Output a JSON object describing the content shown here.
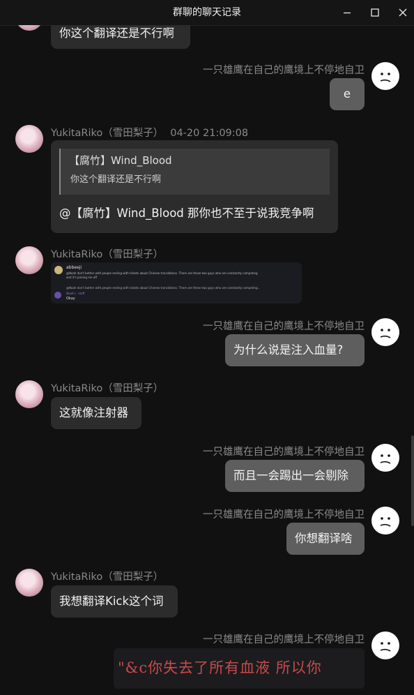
{
  "window": {
    "title": "群聊的聊天记录"
  },
  "users": {
    "left_name": "YukitaRiko（雪田梨子）",
    "right_name": "一只雄鹰在自己的鹰境上不停地自卫"
  },
  "messages": {
    "m0_text": "你这个翻译还是不行啊",
    "m1_text": "e",
    "m2_time": "04-20 21:09:08",
    "m2_quote_name": "【腐竹】Wind_Blood",
    "m2_quote_text": "你这个翻译还是不行啊",
    "m2_text": "@【腐竹】Wind_Blood 那你也不至于说我竞争啊",
    "m3_img_user": "abbeeji",
    "m3_img_line1": "@Noah don't bother with people reeling with tickets about Chinese translations. There are these two guys who are constantly competing",
    "m3_img_line2": "and it's pissing me off",
    "m3_img_reply": "@Noah don't bother with people reeling with tickets about Chinese translations. There are these two guys who are constantly competing...",
    "m3_img_user2": "Noah's · staff",
    "m3_img_okay": "Okay",
    "m4_text": "为什么说是注入血量?",
    "m5_text": "这就像注射器",
    "m6_text": "而且一会踢出一会剔除",
    "m7_text": "你想翻译啥",
    "m8_text": "我想翻译Kick这个词",
    "m9_img_text": "\"&c你失去了所有血液  所以你"
  }
}
